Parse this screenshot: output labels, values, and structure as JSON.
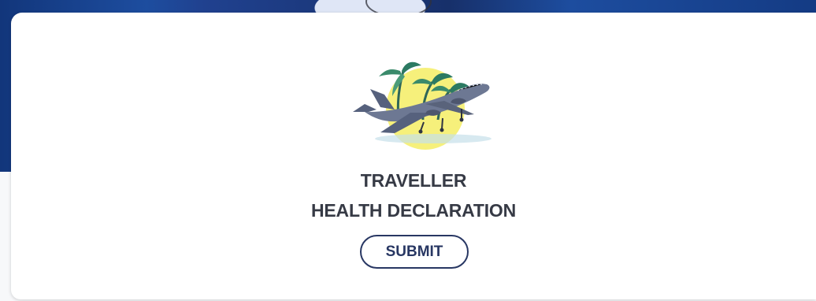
{
  "card": {
    "title_line1": "TRAVELLER",
    "title_line2": "HEALTH DECLARATION",
    "submit_label": "SUBMIT",
    "illustration_icon": "airplane-palm-sun-icon"
  },
  "colors": {
    "header_blue": "#1d4d9f",
    "button_border": "#283763",
    "text": "#363a45",
    "sun_yellow": "#f4f27a"
  }
}
